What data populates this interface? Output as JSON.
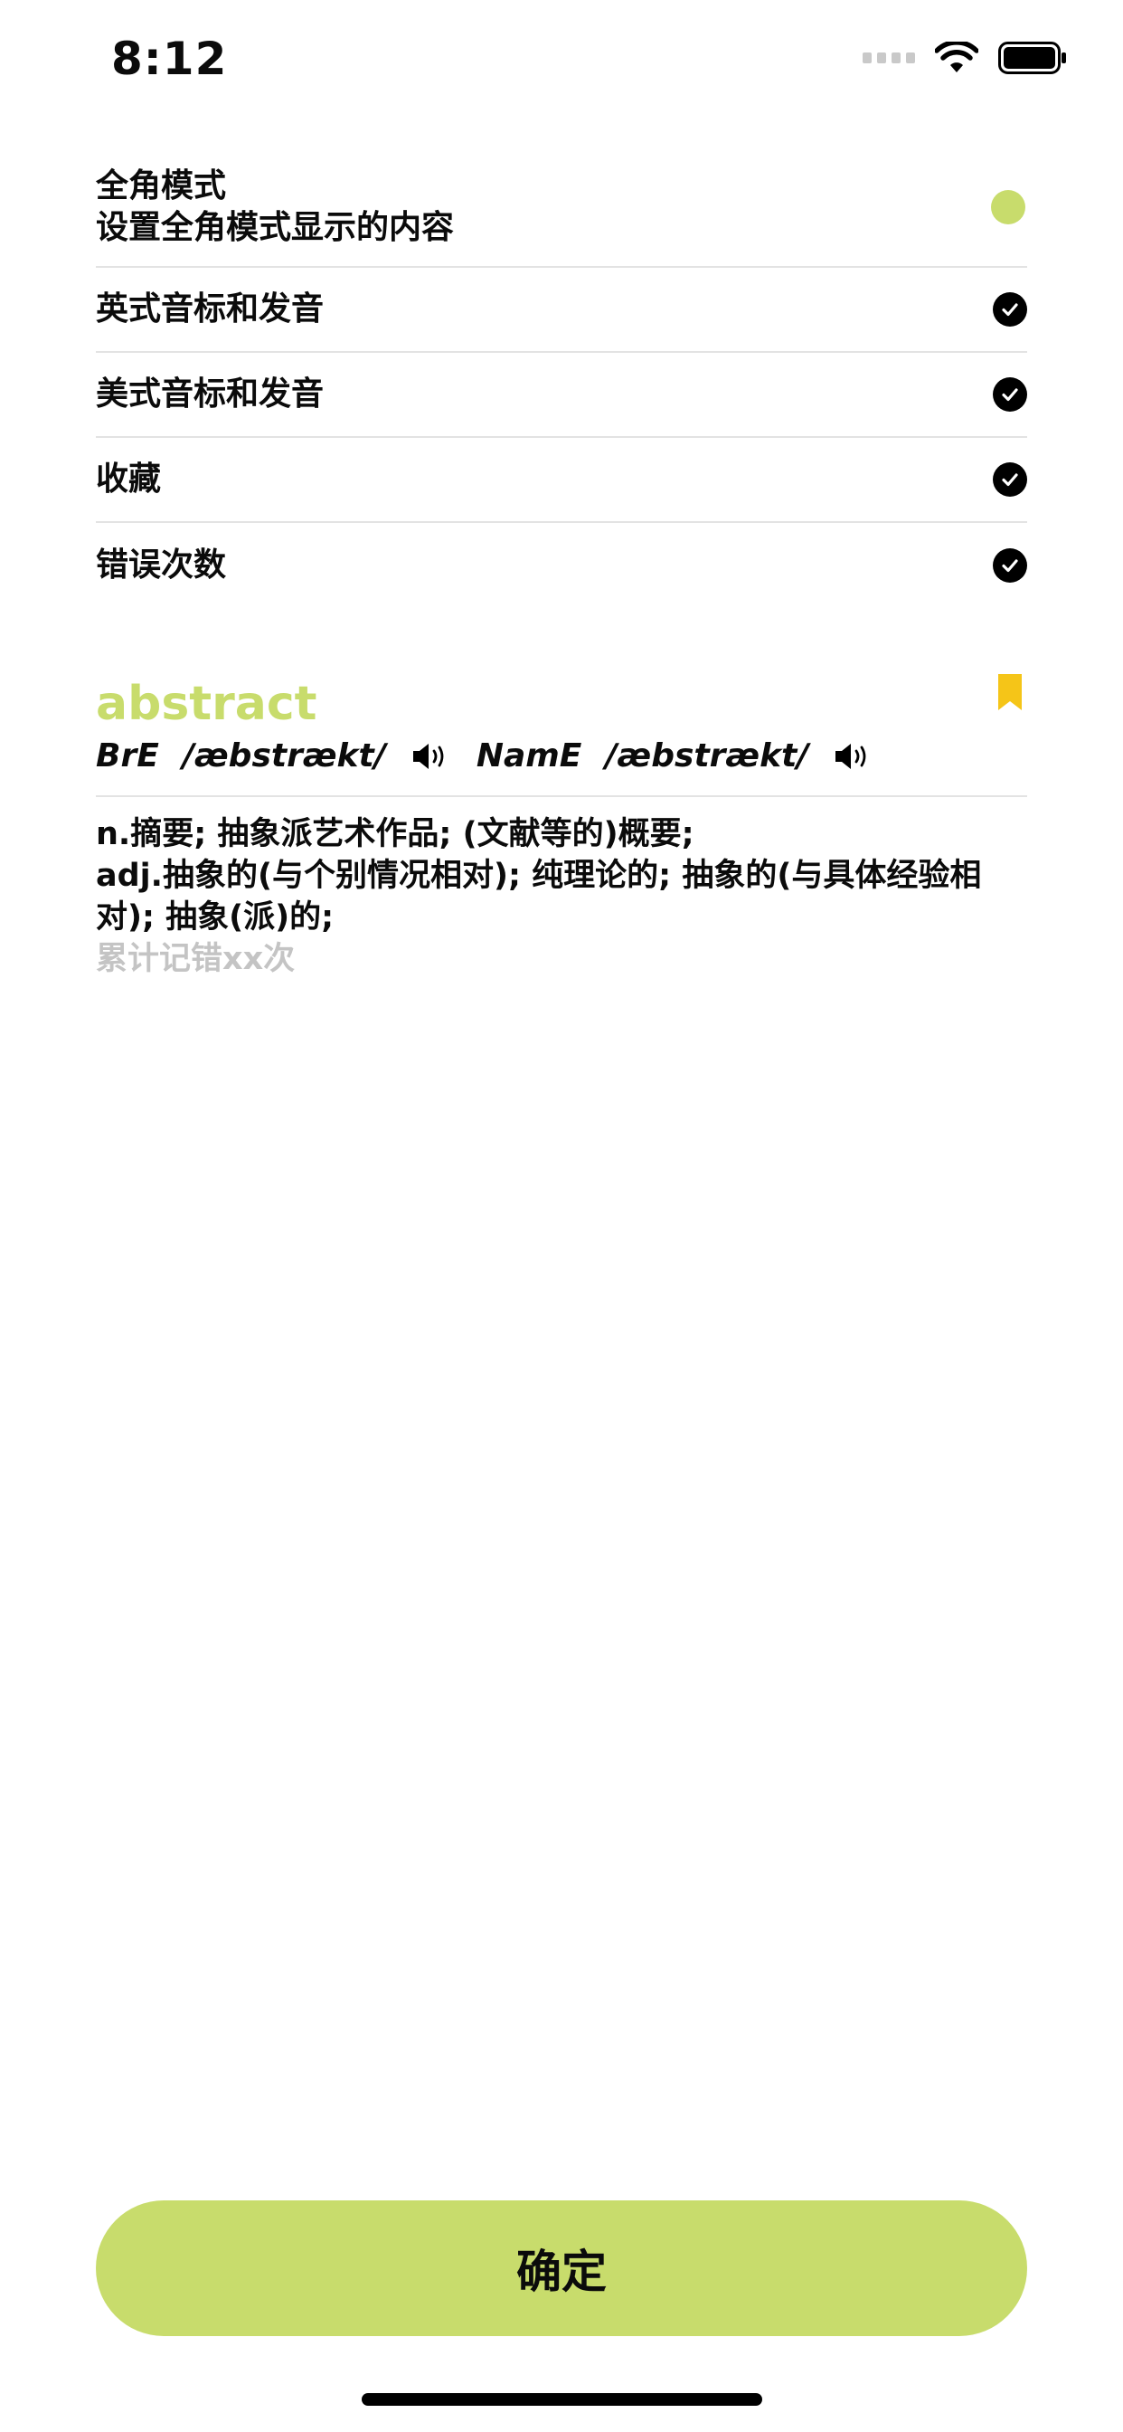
{
  "status_bar": {
    "time": "8:12"
  },
  "settings": {
    "main": {
      "title": "全角模式",
      "subtitle": "设置全角模式显示的内容"
    },
    "options": [
      {
        "label": "英式音标和发音",
        "checked": true
      },
      {
        "label": "美式音标和发音",
        "checked": true
      },
      {
        "label": "收藏",
        "checked": true
      },
      {
        "label": "错误次数",
        "checked": true
      }
    ]
  },
  "word_card": {
    "word": "abstract",
    "bre_label": "BrE",
    "bre_phonetic": "/æbstrækt/",
    "name_label": "NamE",
    "name_phonetic": "/æbstrækt/",
    "definitions": [
      "n.摘要; 抽象派艺术作品; (文献等的)概要;",
      "adj.抽象的(与个别情况相对); 纯理论的; 抽象的(与具体经验相对); 抽象(派)的;"
    ],
    "error_count_text": "累计记错xx次"
  },
  "confirm_button": {
    "label": "确定"
  },
  "colors": {
    "accent": "#c8dc6c",
    "bookmark": "#f5c518",
    "muted_text": "#c4c4c4",
    "divider": "#e3e3e3"
  }
}
